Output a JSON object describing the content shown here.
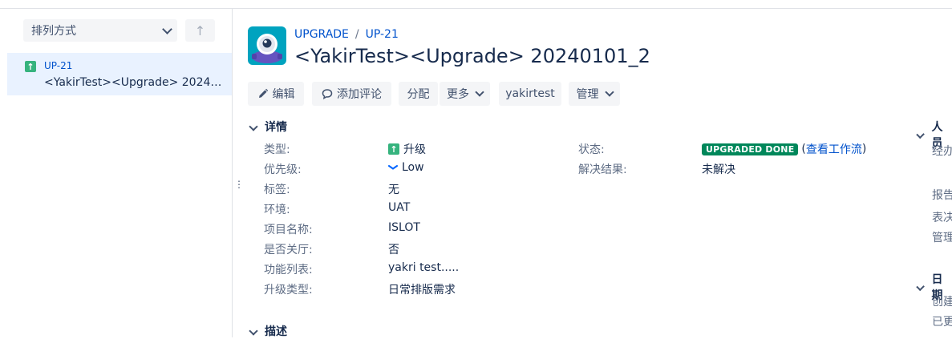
{
  "sidebar": {
    "sort_label": "排列方式",
    "sort_direction_glyph": "↑",
    "issue": {
      "key": "UP-21",
      "summary": "<YakirTest><Upgrade> 202401..."
    }
  },
  "breadcrumb": {
    "project": "UPGRADE",
    "separator": "/",
    "issue_key": "UP-21"
  },
  "issue": {
    "title": "<YakirTest><Upgrade> 20240101_2"
  },
  "toolbar": {
    "edit": "编辑",
    "comment": "添加评论",
    "assign": "分配",
    "more": "更多",
    "yakirtest": "yakirtest",
    "manage": "管理"
  },
  "details": {
    "heading": "详情",
    "type_label": "类型:",
    "type_value": "升级",
    "priority_label": "优先级:",
    "priority_value": "Low",
    "labels_label": "标签:",
    "labels_value": "无",
    "env_label": "环境:",
    "env_value": "UAT",
    "project_name_label": "项目名称:",
    "project_name_value": "ISLOT",
    "close_hall_label": "是否关厅:",
    "close_hall_value": "否",
    "features_label": "功能列表:",
    "features_value": "yakri test.....",
    "upgrade_type_label": "升级类型:",
    "upgrade_type_value": "日常排版需求",
    "status_label": "状态:",
    "status_value": "UPGRADED DONE",
    "workflow_open": "(",
    "workflow_link": "查看工作流",
    "workflow_close": ")",
    "resolution_label": "解决结果:",
    "resolution_value": "未解决"
  },
  "description": {
    "heading": "描述"
  },
  "people": {
    "heading": "人员",
    "assignee_label": "经办",
    "reporter_label": "报告",
    "voters_label": "表决",
    "manager_label": "管理"
  },
  "dates": {
    "heading": "日期",
    "created_label": "创建",
    "updated_label": "已更"
  },
  "colors": {
    "link": "#0052cc",
    "upgrade_type": "#36b37e",
    "status_done": "#00875a",
    "selected_bg": "#e9f2ff",
    "button_bg": "#f4f5f7"
  },
  "icons": {
    "type": "upgrade-arrow-icon",
    "priority": "chevron-down-low-icon",
    "edit": "pencil-icon",
    "comment": "speech-bubble-icon",
    "project_avatar": "robot-avatar-icon"
  }
}
